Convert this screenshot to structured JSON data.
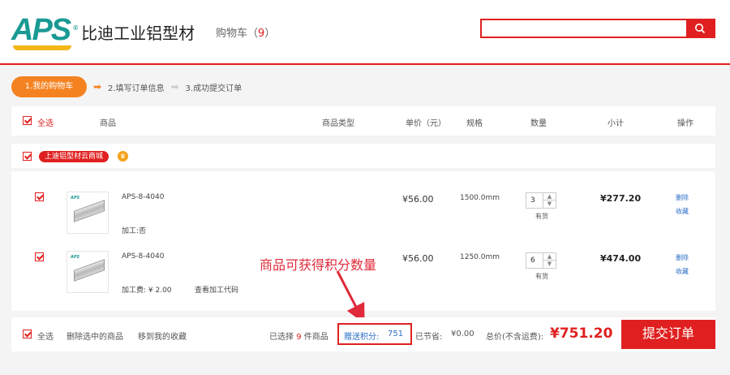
{
  "header": {
    "logo_mark": "APS",
    "logo_reg": "®",
    "logo_text": "比迪工业铝型材",
    "cart_label": "购物车（",
    "cart_count": "9",
    "cart_close": "）",
    "search_value": "",
    "search_placeholder": ""
  },
  "steps": {
    "step1": "1.我的购物车",
    "step2": "2.填写订单信息",
    "step3": "3.成功提交订单"
  },
  "table_header": {
    "select_all": "全选",
    "product": "商品",
    "product_type": "商品类型",
    "unit_price": "单价（元）",
    "spec": "规格",
    "quantity": "数量",
    "subtotal": "小计",
    "actions": "操作"
  },
  "shop": {
    "name": "上迪铝型材云商城"
  },
  "items": [
    {
      "thumb_tag": "APS",
      "name": "APS-8-4040",
      "processing": "加工:否",
      "processing_link": "",
      "price": "¥56.00",
      "spec": "1500.0mm",
      "qty": "3",
      "stock": "有货",
      "subtotal": "¥277.20",
      "delete": "删除",
      "favorite": "收藏"
    },
    {
      "thumb_tag": "APS",
      "name": "APS-8-4040",
      "processing": "加工费: ¥ 2.00",
      "processing_link": "查看加工代码",
      "price": "¥56.00",
      "spec": "1250.0mm",
      "qty": "6",
      "stock": "有货",
      "subtotal": "¥474.00",
      "delete": "删除",
      "favorite": "收藏"
    }
  ],
  "annotation": "商品可获得积分数量",
  "footer": {
    "select_all": "全选",
    "delete_selected": "删除选中的商品",
    "move_to_favorites": "移到我的收藏",
    "selected_prefix": "已选择",
    "selected_count": "9",
    "selected_suffix": "件商品",
    "points_label": "赠送积分:",
    "points_value": "751",
    "saved_label": "已节省:",
    "saved_value": "¥0.00",
    "total_label": "总价(不含运费):",
    "total_value": "¥751.20",
    "submit": "提交订单"
  },
  "colors": {
    "brand_red": "#e02020",
    "step_orange": "#f58220",
    "logo_teal": "#1a9a94",
    "link_blue": "#2b6ec8"
  },
  "icons": {
    "search": "search-icon",
    "step_arrow": "arrow-right-icon",
    "shop_crown": "crown-icon"
  }
}
